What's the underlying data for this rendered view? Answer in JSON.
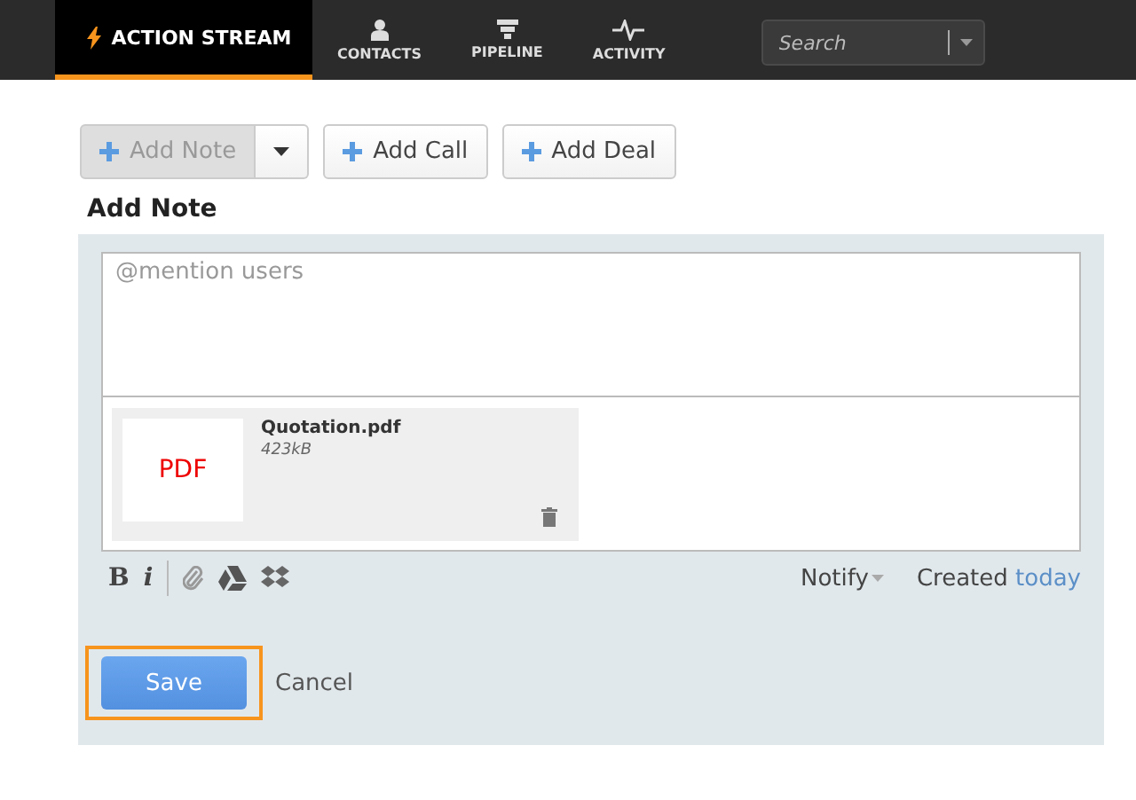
{
  "nav": {
    "tabs": [
      {
        "label": "ACTION STREAM",
        "selected": true
      },
      {
        "label": "CONTACTS",
        "selected": false
      },
      {
        "label": "PIPELINE",
        "selected": false
      },
      {
        "label": "ACTIVITY",
        "selected": false
      }
    ],
    "search": {
      "placeholder": "Search"
    }
  },
  "actions": [
    {
      "label": "Add Note",
      "selected": true,
      "has_menu": true
    },
    {
      "label": "Add Call",
      "selected": false,
      "has_menu": false
    },
    {
      "label": "Add Deal",
      "selected": false,
      "has_menu": false
    }
  ],
  "heading": "Add Note",
  "editor": {
    "placeholder": "@mention users",
    "attachment": {
      "thumb": "PDF",
      "name": "Quotation.pdf",
      "size": "423kB"
    },
    "toolbar": {
      "bold": "B",
      "italic": "i"
    },
    "notify": "Notify",
    "created": "Created",
    "created_when": "today"
  },
  "buttons": [
    {
      "label": "Save",
      "kind": "primary",
      "focused": true
    },
    {
      "label": "Cancel",
      "kind": "link",
      "focused": false
    }
  ]
}
